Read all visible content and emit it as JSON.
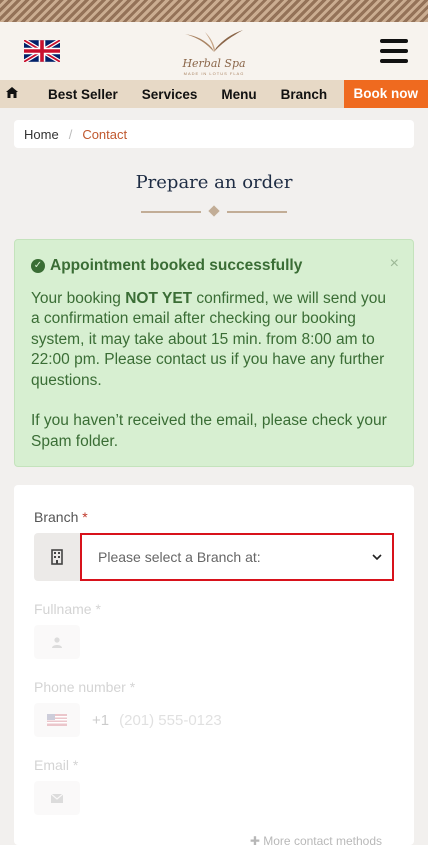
{
  "brand": {
    "logo_text": "Herbal Spa",
    "logo_sub": "MADE IN LOTUS FLAG"
  },
  "nav": {
    "items": [
      "Best Seller",
      "Services",
      "Menu",
      "Branch"
    ],
    "book_label": "Book now"
  },
  "breadcrumb": {
    "home": "Home",
    "current": "Contact"
  },
  "page_title": "Prepare an order",
  "alert": {
    "title": "Appointment booked successfully",
    "close": "×",
    "msg_before": "Your booking ",
    "msg_strong": "NOT YET",
    "msg_after": " confirmed, we will send you a confirmation email after checking our booking system, it may take about 15 min. from 8:00 am to 22:00 pm. Please contact us if you have any further questions.",
    "msg2": "If you haven’t received the email, please check your Spam folder."
  },
  "form": {
    "branch_label": "Branch",
    "required_mark": "*",
    "branch_placeholder": "Please select a Branch at:",
    "fullname_label": "Fullname *",
    "phone_label": "Phone number *",
    "country_code": "+1",
    "phone_placeholder": "(201) 555-0123",
    "email_label": "Email *",
    "more_methods": "More contact methods"
  },
  "colors": {
    "accent": "#ef6a1f",
    "alert_bg": "#d7efd1",
    "select_border": "#d8121b"
  }
}
